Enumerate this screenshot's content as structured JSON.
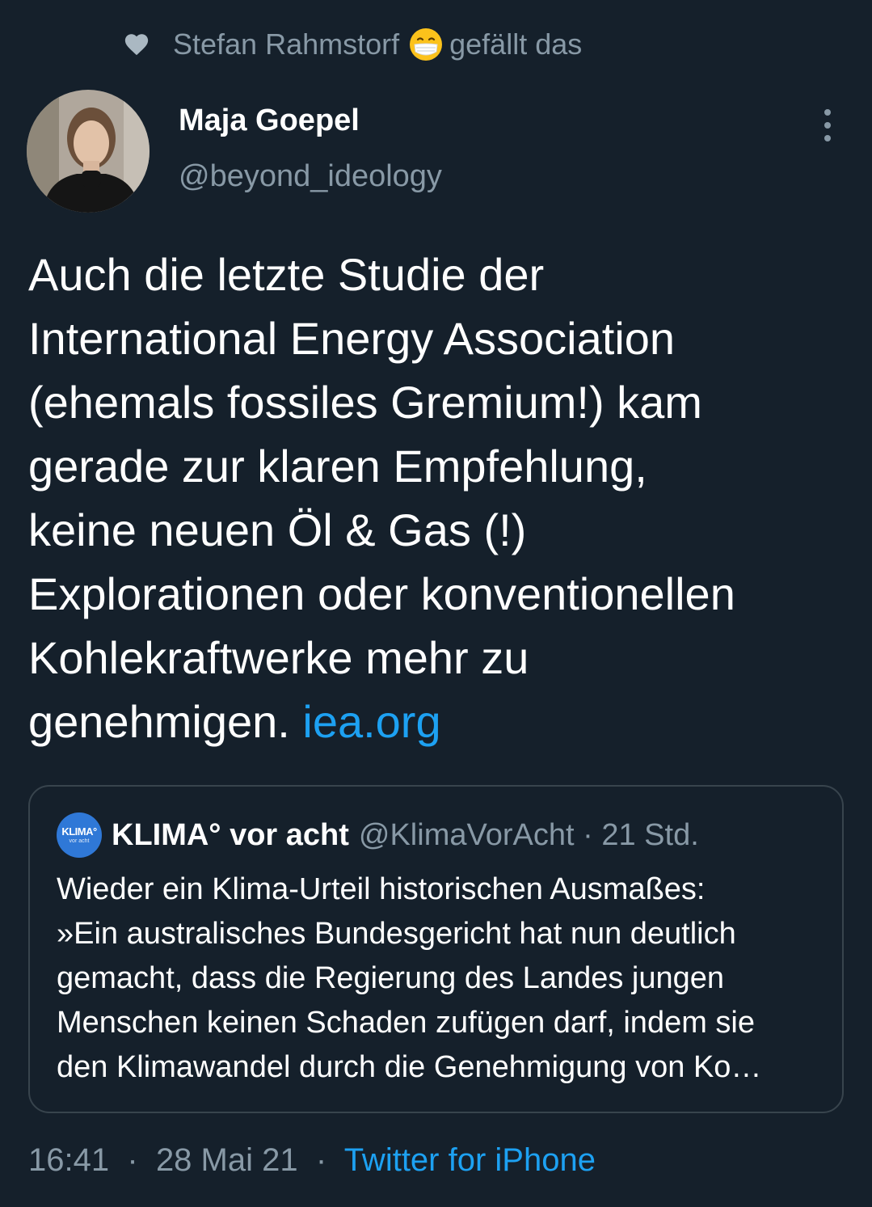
{
  "social_context": {
    "liker": "Stefan Rahmstorf",
    "action": "gefällt das",
    "heart_icon": "heart-icon",
    "emoji_icon": "face-with-medical-mask-emoji"
  },
  "author": {
    "name": "Maja Goepel",
    "handle": "@beyond_ideology",
    "more_icon": "more-vertical-icon"
  },
  "tweet": {
    "lines": [
      "Auch die letzte Studie der",
      "International Energy Association",
      "(ehemals fossiles Gremium!) kam",
      "gerade zur klaren Empfehlung,",
      "keine neuen Öl & Gas (!)",
      "Explorationen oder konventionellen",
      "Kohlekraftwerke mehr zu"
    ],
    "last_line_text": "genehmigen.",
    "link": "iea.org"
  },
  "quote": {
    "avatar_logo": "KLIMA°",
    "avatar_logo_sub": "vor acht",
    "name": "KLIMA° vor acht",
    "handle": "@KlimaVorAcht",
    "separator": "·",
    "time": "21 Std.",
    "lines": [
      "Wieder ein Klima-Urteil historischen Ausmaßes:",
      "»Ein australisches Bundesgericht hat nun deutlich",
      "gemacht, dass die Regierung des Landes jungen",
      "Menschen keinen Schaden zufügen darf, indem sie",
      "den Klimawandel durch die Genehmigung von Ko…"
    ]
  },
  "footer": {
    "time": "16:41",
    "separator": "·",
    "date": "28 Mai 21",
    "source": "Twitter for iPhone"
  },
  "colors": {
    "background": "#15202b",
    "secondary_text": "#8899a6",
    "link": "#1da1f2",
    "border": "#38444d"
  }
}
